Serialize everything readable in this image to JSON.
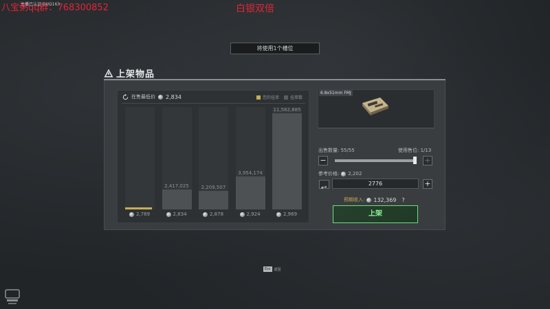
{
  "overlays": {
    "top_left": "八宝粥qq群：768300852",
    "top_left_tiny": "主播已认证 DUO163",
    "top_center": "白银双倍"
  },
  "slot_banner": "将使用1个槽位",
  "panel": {
    "title": "上架物品",
    "item_name": "6.8x51mm FMJ"
  },
  "chart_head": {
    "label": "在售最低价",
    "value": "2,834",
    "legend_mine": "您的挂单",
    "legend_other": "挂单数"
  },
  "chart_data": {
    "type": "bar",
    "categories": [
      "2,789",
      "2,834",
      "2,878",
      "2,924",
      "2,969"
    ],
    "values": [
      70000,
      2417025,
      2209507,
      3954174,
      11582885
    ],
    "data_labels": [
      "",
      "2,417,025",
      "2,209,507",
      "3,954,174",
      "11,582,885"
    ],
    "highlight_index": 0,
    "ylim": [
      0,
      11582885
    ],
    "colors": {
      "bar": "#4d5154",
      "column": "#34373a",
      "mine": "#c7ae56"
    }
  },
  "sell": {
    "qty_label": "出售数量: 55/55",
    "slot_label": "使用售位: 1/13",
    "qty_fraction": 1.0,
    "ref_price_label": "参考价格:",
    "ref_price_value": "2,202",
    "price_input": "2776",
    "income_label": "预期收入:",
    "income_value": "132,369",
    "income_help": "?",
    "list_button": "上架",
    "minus": "−",
    "plus": "+",
    "price_plus": "+"
  },
  "esc_hint": {
    "key": "Esc",
    "label": "返回"
  },
  "colors": {
    "accent_green": "#6fe07d",
    "accent_gold": "#c7ae56",
    "overlay_red": "#e0263a"
  }
}
